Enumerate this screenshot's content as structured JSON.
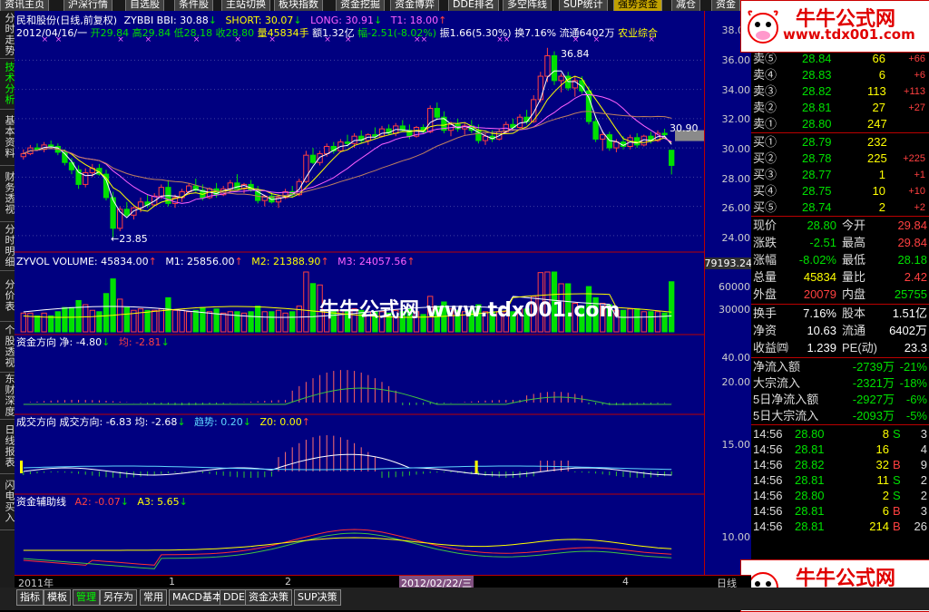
{
  "topbar": {
    "tabs": [
      "资讯主页",
      "沪深行情",
      "自选股",
      "条件股",
      "主站切换",
      "板块指数",
      "资金挖掘",
      "资金博弈",
      "DDE排名",
      "多空阵线",
      "SUP统计",
      "强势资金",
      "减仓",
      "资金"
    ]
  },
  "sidetabs": [
    "分时走势",
    "技术分析",
    "基本资料",
    "财务透视",
    "分时明细",
    "分价表",
    "个股透视",
    "东财深度",
    "日线报表",
    "闪电买入"
  ],
  "header": {
    "line1": {
      "name": "民和股份(日线,前复权)",
      "bbi": "ZYBBI BBI: 30.88",
      "short": "SHORT: 30.07",
      "long": "LONG: 30.91",
      "t1": "T1: 18.00"
    },
    "line2": {
      "date": "2012/04/16/一",
      "open": "开29.84",
      "high": "高29.84",
      "low": "低28.18",
      "close": "收28.80",
      "vol": "量45834手",
      "amt": "额1.32亿",
      "chg": "幅-2.51(-8.02%)",
      "amp": "振1.66(5.30%)",
      "turn": "换7.16%",
      "flow": "流通6402万",
      "ind": "农业综合"
    },
    "vol": {
      "label": "ZYVOL VOLUME: 45834.00",
      "m1": "M1: 25856.00",
      "m2": "M2: 21388.90",
      "m3": "M3: 24057.56",
      "side": "79193.24"
    },
    "fund": {
      "label": "资金方向 净: -4.80",
      "avg": "均: -2.81"
    },
    "deal": {
      "label": "成交方向 成交方向: -6.83 均: -2.68",
      "trend": "趋势: 0.20",
      "z0": "Z0: 0.00"
    },
    "aux": {
      "label": "资金辅助线",
      "a2": "A2: -0.07",
      "a3": "A3: 5.65"
    }
  },
  "price_axis": [
    "38.00",
    "36.00",
    "34.00",
    "32.00",
    "30.00",
    "28.00",
    "26.00",
    "24.00"
  ],
  "vol_axis": [
    "60000",
    "30000"
  ],
  "fund_axis": [
    "40.00",
    "20.00"
  ],
  "deal_axis": [
    "15.00"
  ],
  "aux_axis": [
    "10.00"
  ],
  "annotations": {
    "high": "36.84",
    "low": "23.85",
    "last": "30.90"
  },
  "date_axis": {
    "start": "2011年",
    "m1": "1",
    "m2": "2",
    "cursor": "2012/02/22/三",
    "m4": "4",
    "right": "日线"
  },
  "watermark": "牛牛公式网 www.tdx001.com",
  "logo": {
    "title": "牛牛公式网",
    "url": "www.tdx001.com"
  },
  "quote": {
    "asks": [
      {
        "label": "卖⑤",
        "price": "28.84",
        "vol": "66",
        "chg": "+66"
      },
      {
        "label": "卖④",
        "price": "28.83",
        "vol": "6",
        "chg": "+6"
      },
      {
        "label": "卖③",
        "price": "28.82",
        "vol": "113",
        "chg": "+113"
      },
      {
        "label": "卖②",
        "price": "28.81",
        "vol": "27",
        "chg": "+27"
      },
      {
        "label": "卖①",
        "price": "28.80",
        "vol": "247",
        "chg": ""
      }
    ],
    "bids": [
      {
        "label": "买①",
        "price": "28.79",
        "vol": "232",
        "chg": ""
      },
      {
        "label": "买②",
        "price": "28.78",
        "vol": "225",
        "chg": "+225"
      },
      {
        "label": "买③",
        "price": "28.77",
        "vol": "1",
        "chg": "+1"
      },
      {
        "label": "买④",
        "price": "28.75",
        "vol": "10",
        "chg": "+10"
      },
      {
        "label": "买⑤",
        "price": "28.74",
        "vol": "2",
        "chg": "+2"
      }
    ],
    "stats": [
      {
        "l1": "现价",
        "v1": "28.80",
        "l2": "今开",
        "v2": "29.84"
      },
      {
        "l1": "涨跌",
        "v1": "-2.51",
        "l2": "最高",
        "v2": "29.84"
      },
      {
        "l1": "涨幅",
        "v1": "-8.02%",
        "l2": "最低",
        "v2": "28.18"
      },
      {
        "l1": "总量",
        "v1": "45834",
        "l2": "量比",
        "v2": "2.42"
      },
      {
        "l1": "外盘",
        "v1": "20079",
        "l2": "内盘",
        "v2": "25755"
      }
    ],
    "stats2": [
      {
        "l1": "换手",
        "v1": "7.16%",
        "l2": "股本",
        "v2": "1.51亿"
      },
      {
        "l1": "净资",
        "v1": "10.63",
        "l2": "流通",
        "v2": "6402万"
      },
      {
        "l1": "收益㈣",
        "v1": "1.239",
        "l2": "PE(动)",
        "v2": "23.3"
      }
    ],
    "flows": [
      {
        "label": "净流入额",
        "val": "-2739万",
        "pct": "-21%"
      },
      {
        "label": "大宗流入",
        "val": "-2321万",
        "pct": "-18%"
      },
      {
        "label": "5日净流入额",
        "val": "-2927万",
        "pct": "-6%"
      },
      {
        "label": "5日大宗流入",
        "val": "-2093万",
        "pct": "-5%"
      }
    ],
    "ticks": [
      {
        "t": "14:56",
        "p": "28.80",
        "v": "8",
        "s": "S",
        "n": "3"
      },
      {
        "t": "14:56",
        "p": "28.81",
        "v": "16",
        "s": "",
        "n": "4"
      },
      {
        "t": "14:56",
        "p": "28.82",
        "v": "32",
        "s": "B",
        "n": "9"
      },
      {
        "t": "14:56",
        "p": "28.81",
        "v": "11",
        "s": "S",
        "n": "2"
      },
      {
        "t": "14:56",
        "p": "28.80",
        "v": "2",
        "s": "S",
        "n": "2"
      },
      {
        "t": "14:56",
        "p": "28.81",
        "v": "6",
        "s": "B",
        "n": "3"
      },
      {
        "t": "14:56",
        "p": "28.81",
        "v": "214",
        "s": "B",
        "n": "26"
      }
    ]
  },
  "bottombar": [
    "指标",
    "模板",
    "管理",
    "另存为",
    "常用",
    "MACD基本",
    "DDE",
    "资金决策",
    "SUP决策"
  ],
  "colors": {
    "bg": "#000080",
    "up": "#ff4040",
    "down": "#00e000",
    "accent": "#ffff00"
  },
  "chart_data": {
    "type": "candlestick",
    "ylim": [
      23,
      38.5
    ],
    "candles": [
      [
        29.4,
        29.9,
        29.2,
        29.6
      ],
      [
        29.6,
        30.2,
        29.5,
        30.0
      ],
      [
        30.0,
        30.3,
        29.8,
        29.9
      ],
      [
        29.9,
        30.4,
        29.7,
        30.2
      ],
      [
        30.2,
        30.5,
        30.0,
        30.1
      ],
      [
        30.1,
        30.3,
        29.5,
        29.7
      ],
      [
        29.7,
        29.9,
        28.8,
        29.0
      ],
      [
        29.0,
        29.3,
        28.2,
        28.5
      ],
      [
        28.5,
        28.8,
        27.2,
        27.5
      ],
      [
        27.5,
        28.6,
        27.3,
        28.3
      ],
      [
        28.3,
        28.9,
        28.0,
        28.6
      ],
      [
        28.6,
        28.9,
        28.1,
        28.2
      ],
      [
        28.2,
        28.5,
        26.4,
        26.6
      ],
      [
        26.6,
        27.0,
        23.85,
        24.5
      ],
      [
        24.5,
        26.0,
        24.3,
        25.8
      ],
      [
        25.8,
        26.3,
        25.2,
        25.4
      ],
      [
        25.4,
        26.0,
        25.1,
        25.9
      ],
      [
        25.9,
        26.6,
        25.6,
        26.3
      ],
      [
        26.3,
        26.8,
        25.9,
        26.1
      ],
      [
        26.1,
        26.9,
        26.0,
        26.7
      ],
      [
        26.7,
        27.5,
        26.5,
        27.3
      ],
      [
        27.3,
        27.8,
        26.0,
        26.2
      ],
      [
        26.2,
        26.8,
        25.9,
        26.6
      ],
      [
        26.6,
        27.2,
        26.3,
        27.0
      ],
      [
        27.0,
        27.6,
        26.8,
        27.4
      ],
      [
        27.4,
        27.9,
        27.0,
        27.1
      ],
      [
        27.1,
        27.5,
        26.4,
        26.6
      ],
      [
        26.6,
        27.3,
        26.5,
        27.2
      ],
      [
        27.2,
        27.6,
        26.6,
        26.8
      ],
      [
        26.8,
        27.4,
        26.7,
        27.2
      ],
      [
        27.2,
        27.8,
        27.0,
        27.6
      ],
      [
        27.6,
        28.2,
        27.4,
        27.2
      ],
      [
        27.2,
        27.6,
        26.9,
        27.5
      ],
      [
        27.5,
        27.8,
        27.0,
        27.1
      ],
      [
        27.1,
        27.4,
        26.2,
        26.4
      ],
      [
        26.4,
        26.8,
        26.0,
        26.7
      ],
      [
        26.7,
        27.0,
        26.2,
        26.3
      ],
      [
        26.3,
        26.8,
        25.9,
        26.6
      ],
      [
        26.6,
        27.2,
        26.5,
        27.0
      ],
      [
        27.0,
        27.4,
        26.6,
        26.8
      ],
      [
        26.8,
        27.9,
        26.7,
        27.7
      ],
      [
        27.7,
        29.8,
        27.6,
        29.5
      ],
      [
        29.5,
        30.0,
        28.9,
        29.0
      ],
      [
        29.0,
        29.8,
        28.8,
        29.6
      ],
      [
        29.6,
        30.3,
        29.4,
        30.1
      ],
      [
        30.1,
        30.4,
        29.6,
        29.8
      ],
      [
        29.8,
        30.6,
        29.7,
        30.4
      ],
      [
        30.4,
        30.9,
        30.1,
        30.3
      ],
      [
        30.3,
        31.0,
        30.0,
        30.8
      ],
      [
        30.8,
        31.2,
        30.3,
        30.5
      ],
      [
        30.5,
        31.0,
        30.2,
        30.9
      ],
      [
        30.9,
        31.4,
        30.6,
        30.8
      ],
      [
        30.8,
        31.5,
        30.7,
        31.3
      ],
      [
        31.3,
        31.6,
        30.9,
        31.0
      ],
      [
        31.0,
        31.7,
        30.8,
        31.5
      ],
      [
        31.5,
        31.9,
        31.1,
        31.2
      ],
      [
        31.2,
        31.6,
        30.6,
        30.8
      ],
      [
        30.8,
        31.5,
        30.7,
        31.4
      ],
      [
        31.4,
        31.6,
        31.0,
        31.1
      ],
      [
        31.1,
        32.9,
        31.0,
        32.7
      ],
      [
        32.7,
        33.1,
        31.9,
        32.1
      ],
      [
        32.1,
        32.5,
        31.0,
        31.2
      ],
      [
        31.2,
        31.8,
        30.8,
        31.6
      ],
      [
        31.6,
        32.0,
        31.1,
        31.3
      ],
      [
        31.3,
        31.7,
        30.9,
        31.5
      ],
      [
        31.5,
        31.9,
        31.0,
        31.2
      ],
      [
        31.2,
        31.6,
        30.3,
        30.5
      ],
      [
        30.5,
        31.0,
        30.2,
        30.8
      ],
      [
        30.8,
        31.2,
        30.4,
        30.6
      ],
      [
        30.6,
        31.3,
        30.5,
        31.1
      ],
      [
        31.1,
        31.8,
        31.0,
        31.6
      ],
      [
        31.6,
        32.0,
        31.2,
        31.4
      ],
      [
        31.4,
        32.3,
        31.3,
        32.1
      ],
      [
        32.1,
        32.6,
        31.6,
        31.8
      ],
      [
        31.8,
        33.6,
        31.7,
        33.3
      ],
      [
        33.3,
        35.2,
        33.1,
        34.9
      ],
      [
        34.9,
        36.84,
        34.5,
        36.3
      ],
      [
        36.3,
        36.6,
        34.3,
        34.6
      ],
      [
        34.6,
        35.1,
        33.8,
        34.9
      ],
      [
        34.9,
        35.2,
        33.9,
        34.1
      ],
      [
        34.1,
        34.9,
        33.5,
        34.6
      ],
      [
        34.6,
        34.9,
        33.7,
        33.9
      ],
      [
        33.9,
        34.2,
        31.6,
        31.8
      ],
      [
        31.8,
        32.2,
        30.4,
        30.6
      ],
      [
        30.6,
        31.2,
        29.8,
        30.9
      ],
      [
        30.9,
        31.1,
        29.8,
        30.0
      ],
      [
        30.0,
        30.6,
        29.7,
        30.4
      ],
      [
        30.4,
        30.8,
        29.9,
        30.1
      ],
      [
        30.1,
        30.9,
        29.9,
        30.7
      ],
      [
        30.7,
        31.0,
        30.0,
        30.2
      ],
      [
        30.2,
        30.9,
        30.1,
        30.8
      ],
      [
        30.8,
        31.1,
        30.3,
        30.5
      ],
      [
        30.5,
        31.2,
        30.4,
        31.0
      ],
      [
        31.0,
        31.31,
        30.6,
        30.9
      ],
      [
        29.84,
        29.84,
        28.18,
        28.8
      ]
    ],
    "volume_max": 79193
  }
}
